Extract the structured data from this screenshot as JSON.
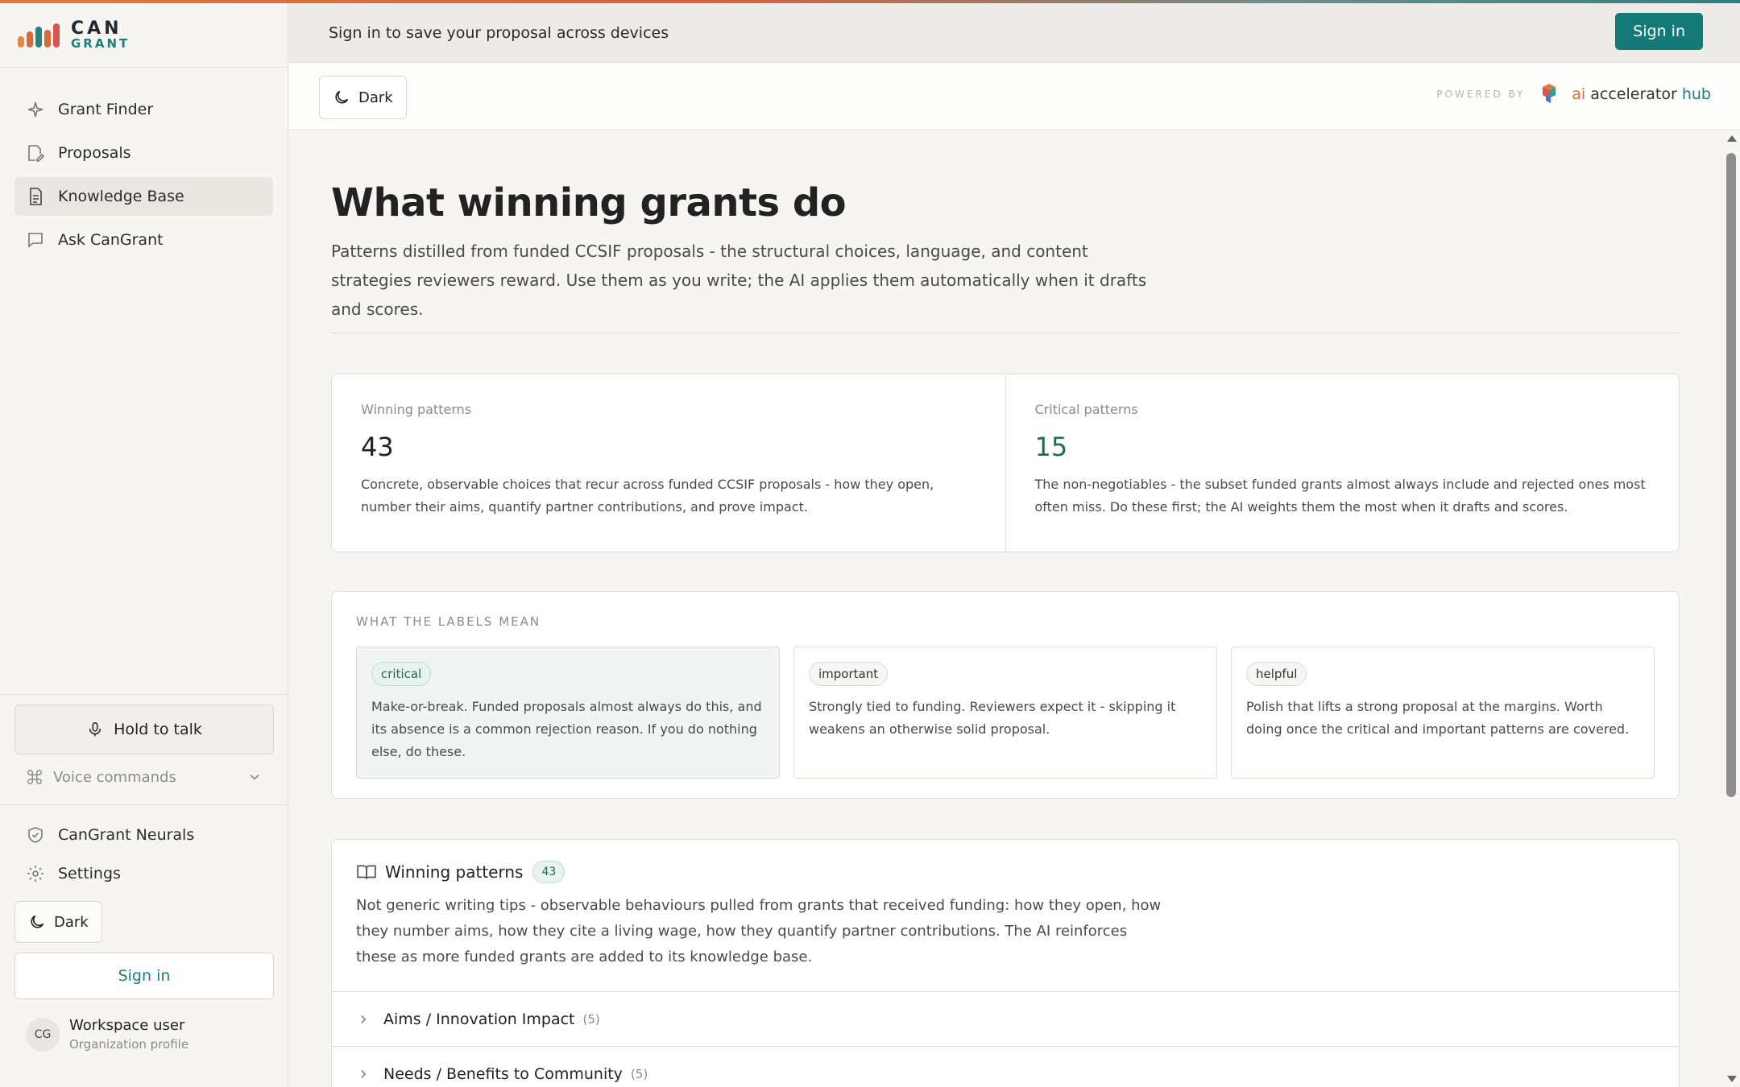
{
  "brand": {
    "line1": "CAN",
    "line2": "GRANT"
  },
  "sidebar": {
    "nav": [
      {
        "label": "Grant Finder",
        "icon": "sparkle-icon"
      },
      {
        "label": "Proposals",
        "icon": "edit-icon"
      },
      {
        "label": "Knowledge Base",
        "icon": "document-icon",
        "active": true
      },
      {
        "label": "Ask CanGrant",
        "icon": "chat-icon"
      }
    ],
    "hold_to_talk": "Hold to talk",
    "voice_commands": "Voice commands",
    "neurals": "CanGrant Neurals",
    "settings": "Settings",
    "dark": "Dark",
    "sign_in": "Sign in",
    "user": {
      "initials": "CG",
      "name": "Workspace user",
      "sub": "Organization profile"
    }
  },
  "banner": {
    "text": "Sign in to save your proposal across devices",
    "sign_in": "Sign in"
  },
  "toolbar": {
    "dark": "Dark",
    "powered_by": "POWERED BY",
    "hub": {
      "ai": "ai",
      "accelerator": "accelerator",
      "hub": "hub"
    }
  },
  "page": {
    "title": "What winning grants do",
    "lede": "Patterns distilled from funded CCSIF proposals - the structural choices, language, and content strategies reviewers reward. Use them as you write; the AI applies them automatically when it drafts and scores."
  },
  "stats": [
    {
      "label": "Winning patterns",
      "value": "43",
      "desc": "Concrete, observable choices that recur across funded CCSIF proposals - how they open, number their aims, quantify partner contributions, and prove impact."
    },
    {
      "label": "Critical patterns",
      "value": "15",
      "desc": "The non-negotiables - the subset funded grants almost always include and rejected ones most often miss. Do these first; the AI weights them the most when it drafts and scores."
    }
  ],
  "labels": {
    "heading": "WHAT THE LABELS MEAN",
    "items": [
      {
        "tag": "critical",
        "text": "Make-or-break. Funded proposals almost always do this, and its absence is a common rejection reason. If you do nothing else, do these."
      },
      {
        "tag": "important",
        "text": "Strongly tied to funding. Reviewers expect it - skipping it weakens an otherwise solid proposal."
      },
      {
        "tag": "helpful",
        "text": "Polish that lifts a strong proposal at the margins. Worth doing once the critical and important patterns are covered."
      }
    ]
  },
  "winning": {
    "title": "Winning patterns",
    "count": "43",
    "desc": "Not generic writing tips - observable behaviours pulled from grants that received funding: how they open, how they number aims, how they cite a living wage, how they quantify partner contributions. The AI reinforces these as more funded grants are added to its knowledge base.",
    "sections": [
      {
        "label": "Aims / Innovation Impact",
        "count": "(5)"
      },
      {
        "label": "Needs / Benefits to Community",
        "count": "(5)"
      }
    ]
  },
  "colors": {
    "accent": "#137a78",
    "critical_green": "#1f6e4b",
    "ai_orange": "#e06a36"
  }
}
